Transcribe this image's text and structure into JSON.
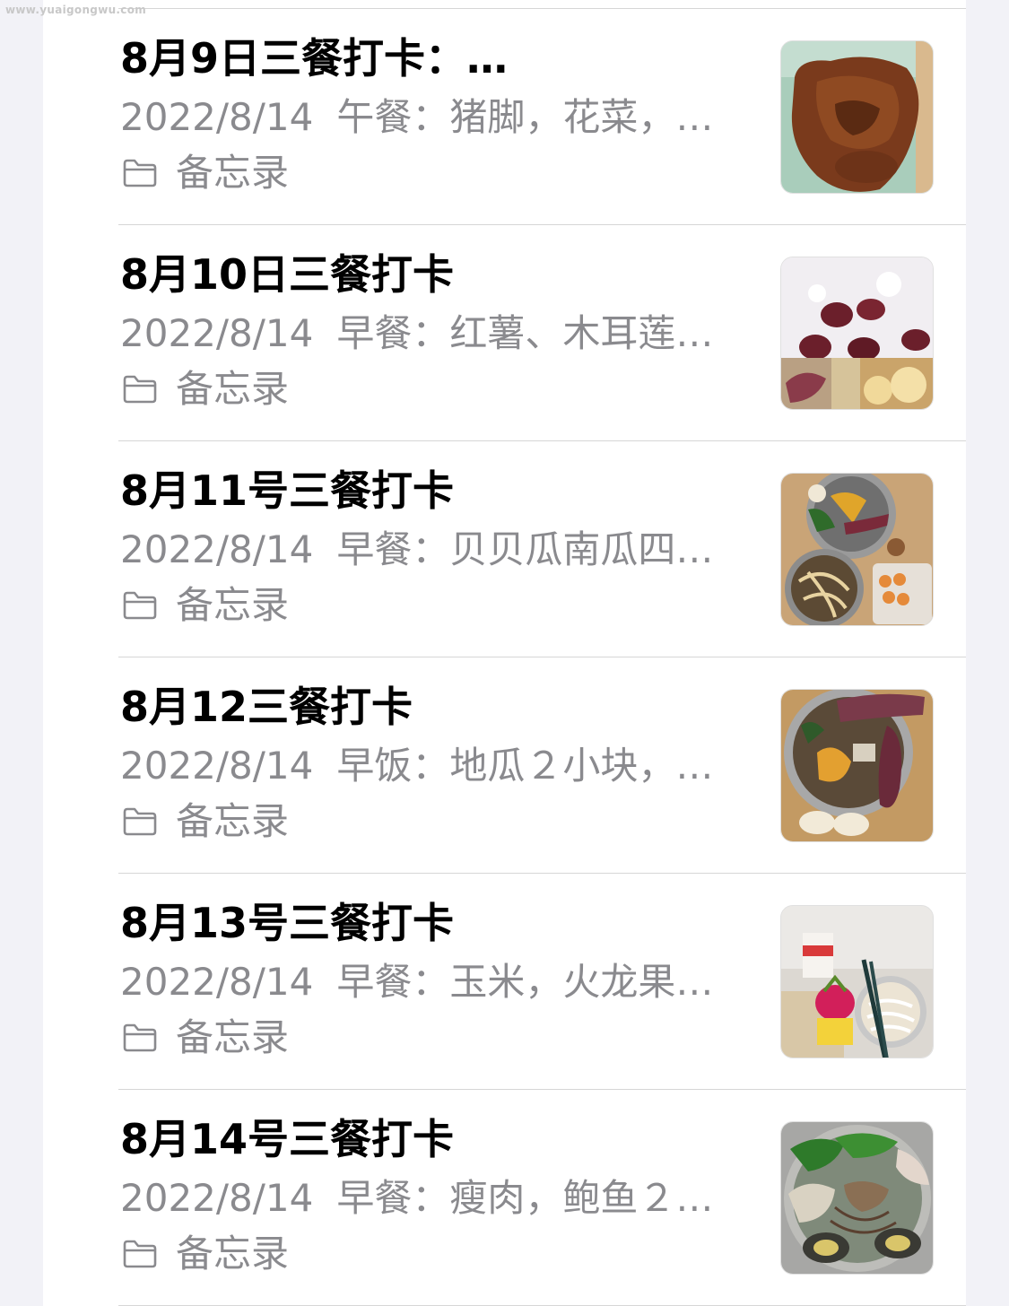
{
  "watermark": "www.yuaigongwu.com",
  "notes": [
    {
      "title": "8月9日三餐打卡：…",
      "date": "2022/8/14",
      "preview": "午餐：猪脚，花菜，…",
      "folder": "备忘录",
      "thumb_icon": "pork-trotter-photo"
    },
    {
      "title": "8月10日三餐打卡",
      "date": "2022/8/14",
      "preview": "早餐：红薯、木耳莲…",
      "folder": "备忘录",
      "thumb_icon": "porridge-photo"
    },
    {
      "title": "8月11号三餐打卡",
      "date": "2022/8/14",
      "preview": "早餐：贝贝瓜南瓜四…",
      "folder": "备忘录",
      "thumb_icon": "pumpkin-pot-photo"
    },
    {
      "title": "8月12三餐打卡",
      "date": "2022/8/14",
      "preview": "早饭：地瓜２小块，…",
      "folder": "备忘录",
      "thumb_icon": "sweet-potato-photo"
    },
    {
      "title": "8月13号三餐打卡",
      "date": "2022/8/14",
      "preview": "早餐：玉米，火龙果…",
      "folder": "备忘录",
      "thumb_icon": "dragonfruit-noodles-photo"
    },
    {
      "title": "8月14号三餐打卡",
      "date": "2022/8/14",
      "preview": "早餐：瘦肉，鲍鱼２…",
      "folder": "备忘录",
      "thumb_icon": "abalone-soup-photo"
    }
  ]
}
